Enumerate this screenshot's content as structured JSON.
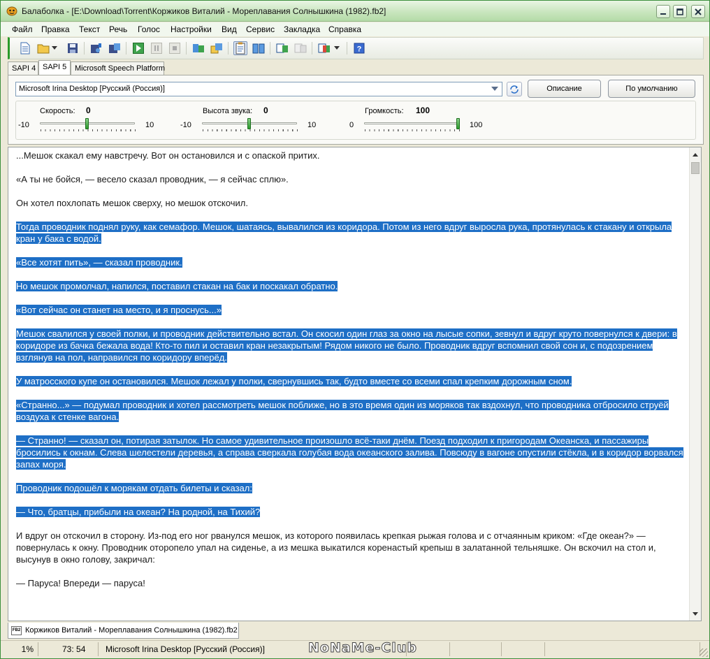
{
  "window": {
    "title": "Балаболка - [E:\\Download\\Torrent\\Коржиков Виталий - Мореплавания Солнышкина (1982).fb2]"
  },
  "menu": [
    "Файл",
    "Правка",
    "Текст",
    "Речь",
    "Голос",
    "Настройки",
    "Вид",
    "Сервис",
    "Закладка",
    "Справка"
  ],
  "tabs": [
    "SAPI 4",
    "SAPI 5",
    "Microsoft Speech Platform"
  ],
  "selected_tab": "SAPI 5",
  "voice": {
    "selected": "Microsoft Irina Desktop [Русский (Россия)]",
    "description_button": "Описание",
    "default_button": "По умолчанию"
  },
  "sliders": {
    "speed": {
      "label": "Скорость:",
      "value": "0",
      "min": "-10",
      "max": "10",
      "level": 0.5
    },
    "pitch": {
      "label": "Высота звука:",
      "value": "0",
      "min": "-10",
      "max": "10",
      "level": 0.5
    },
    "volume": {
      "label": "Громкость:",
      "value": "100",
      "min": "0",
      "max": "100",
      "level": 1.0
    }
  },
  "colors": {
    "selection": "#1e6fc6",
    "accent": "#2a9a2a"
  },
  "text": {
    "paragraphs": [
      {
        "text": "...Мешок скакал ему навстречу. Вот он остановился и с опаской притих.",
        "selected": false
      },
      {
        "text": "«А ты не бойся, — весело сказал проводник, — я сейчас сплю».",
        "selected": false
      },
      {
        "text": "Он хотел похлопать мешок сверху, но мешок отскочил.",
        "selected": false
      },
      {
        "text": "Тогда проводник поднял руку, как семафор. Мешок, шатаясь, вывалился из коридора. Потом из него вдруг выросла рука, протянулась к стакану и открыла кран у бака с водой.",
        "selected": true
      },
      {
        "text": "«Все хотят пить», — сказал проводник.",
        "selected": true
      },
      {
        "text": "Но мешок промолчал, напился, поставил стакан на бак и поскакал обратно.",
        "selected": true
      },
      {
        "text": "«Вот сейчас он станет на место, и я проснусь...»",
        "selected": true
      },
      {
        "text": "Мешок свалился у своей полки, и проводник действительно встал. Он скосил один глаз за окно на лысые сопки, зевнул и вдруг круто повернулся к двери: в коридоре из бачка бежала вода! Кто-то пил и оставил кран незакрытым! Рядом никого не было. Проводник вдруг вспомнил свой сон и, с подозрением взглянув на пол, направился по коридору вперёд.",
        "selected": true
      },
      {
        "text": "У матросского купе он остановился. Мешок лежал у полки, свернувшись так, будто вместе со всеми спал крепким дорожным сном.",
        "selected": true
      },
      {
        "text": "«Странно...» — подумал проводник и хотел рассмотреть мешок поближе, но в это время один из моряков так вздохнул, что проводника отбросило струёй воздуха к стенке вагона.",
        "selected": true
      },
      {
        "text": "— Странно! — сказал он, потирая затылок. Но самое удивительное произошло всё-таки днём. Поезд подходил к пригородам Океанска, и пассажиры бросились к окнам. Слева шелестели деревья, а справа сверкала голубая вода океанского залива. Повсюду в вагоне опустили стёкла, и в коридор ворвался запах моря.",
        "selected": true
      },
      {
        "text": "Проводник подошёл к морякам отдать билеты и сказал:",
        "selected": true
      },
      {
        "text": "— Что, братцы, прибыли на океан? На родной, на Тихий?",
        "selected": true
      },
      {
        "text": "И вдруг он отскочил в сторону. Из-под его ног рванулся мешок, из которого появилась крепкая рыжая голова и с отчаянным криком: «Где океан?» — повернулась к окну. Проводник оторопело упал на сиденье, а из мешка выкатился коренастый крепыш в залатанной тельняшке. Он вскочил на стол и, высунув в окно голову, закричал:",
        "selected": false
      },
      {
        "text": "— Паруса! Впереди — паруса!",
        "selected": false
      }
    ]
  },
  "document_tab": {
    "icon_label": "FB2",
    "label": "Коржиков Виталий - Мореплавания Солнышкина (1982).fb2"
  },
  "status": {
    "percent": "1%",
    "position": "73:  54",
    "voice": "Microsoft Irina Desktop [Русский (Россия)]"
  },
  "watermark": "NoNaMe-Club"
}
